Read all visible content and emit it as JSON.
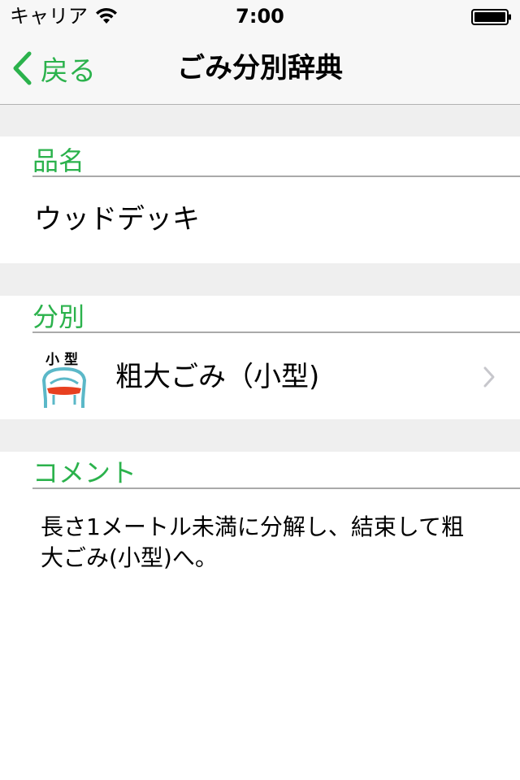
{
  "status_bar": {
    "carrier": "キャリア",
    "time": "7:00"
  },
  "nav": {
    "back_label": "戻る",
    "title": "ごみ分別辞典"
  },
  "sections": {
    "item_name": {
      "header": "品名",
      "value": "ウッドデッキ"
    },
    "category": {
      "header": "分別",
      "icon_label": "小型",
      "value": "粗大ごみ（小型)"
    },
    "comment": {
      "header": "コメント",
      "value": "長さ1メートル未満に分解し、結束して粗\n大ごみ(小型)へ。"
    }
  },
  "colors": {
    "accent": "#2bb24c",
    "icon_chair_frame": "#5bb8c8",
    "icon_chair_seat": "#e84020"
  },
  "icons": {
    "wifi": "wifi-icon",
    "battery": "battery-icon",
    "back": "chevron-left-icon",
    "row_disclosure": "chevron-right-icon",
    "category": "chair-icon"
  }
}
